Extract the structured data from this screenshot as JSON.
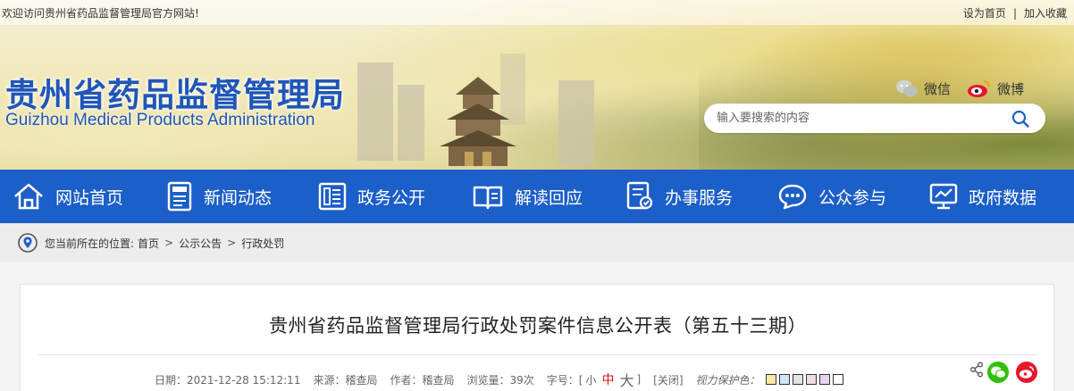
{
  "topbar": {
    "welcome": "欢迎访问贵州省药品监督管理局官方网站!",
    "set_home": "设为首页",
    "separator": "|",
    "favorite": "加入收藏"
  },
  "header": {
    "title_cn": "贵州省药品监督管理局",
    "title_en": "Guizhou Medical Products Administration",
    "wechat_label": "微信",
    "weibo_label": "微博",
    "search_placeholder": "输入要搜索的内容"
  },
  "nav": {
    "items": [
      {
        "label": "网站首页",
        "icon": "home-icon"
      },
      {
        "label": "新闻动态",
        "icon": "news-icon"
      },
      {
        "label": "政务公开",
        "icon": "document-icon"
      },
      {
        "label": "解读回应",
        "icon": "book-icon"
      },
      {
        "label": "办事服务",
        "icon": "service-form-icon"
      },
      {
        "label": "公众参与",
        "icon": "chat-icon"
      },
      {
        "label": "政府数据",
        "icon": "data-chart-icon"
      }
    ]
  },
  "breadcrumb": {
    "prefix": "您当前所在的位置:",
    "items": [
      "首页",
      "公示公告",
      "行政处罚"
    ],
    "arrow": ">"
  },
  "article": {
    "title": "贵州省药品监督管理局行政处罚案件信息公开表（第五十三期）",
    "date": "日期：2021-12-28 15:12:11",
    "source": "来源：稽查局",
    "author": "作者：稽查局",
    "views": "浏览量：39次",
    "font_label": "字号：[",
    "font_small": "小",
    "font_mid": "中",
    "font_big": "大",
    "font_close": "]",
    "close": "[关闭]",
    "eye_label": "视力保护色：",
    "swatches": [
      "#f7e8a6",
      "#cfe6f5",
      "#e3e3e3",
      "#f0dede",
      "#e5d4f0",
      "#ffffff"
    ]
  },
  "colors": {
    "nav_bg": "#1c5fc8",
    "title_blue": "#1f56b8",
    "accent_red": "#d11111",
    "wechat_green": "#2dc100",
    "weibo_red": "#e6162d"
  }
}
